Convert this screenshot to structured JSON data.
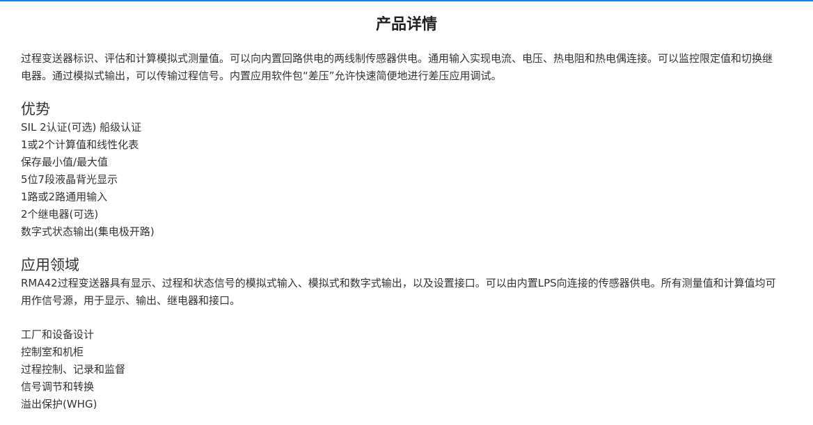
{
  "page": {
    "title": "产品详情"
  },
  "intro": "过程变送器标识、评估和计算模拟式测量值。可以向内置回路供电的两线制传感器供电。通用输入实现电流、电压、热电阻和热电偶连接。可以监控限定值和切换继电器。通过模拟式输出，可以传输过程信号。内置应用软件包“差压”允许快速简便地进行差压应用调试。",
  "advantages": {
    "heading": "优势",
    "items": [
      "SIL 2认证(可选) 船级认证",
      "1或2个计算值和线性化表",
      "保存最小值/最大值",
      "5位7段液晶背光显示",
      "1路或2路通用输入",
      "2个继电器(可选)",
      "数字式状态输出(集电极开路)"
    ]
  },
  "applications": {
    "heading": "应用领域",
    "description": "RMA42过程变送器具有显示、过程和状态信号的模拟式输入、模拟式和数字式输出，以及设置接口。可以由内置LPS向连接的传感器供电。所有测量值和计算值均可用作信号源，用于显示、输出、继电器和接口。",
    "items": [
      "工厂和设备设计",
      "控制室和机柜",
      "过程控制、记录和监督",
      "信号调节和转换",
      "溢出保护(WHG)"
    ]
  },
  "colors": {
    "accent": "#1a7fd4",
    "text": "#333333"
  }
}
